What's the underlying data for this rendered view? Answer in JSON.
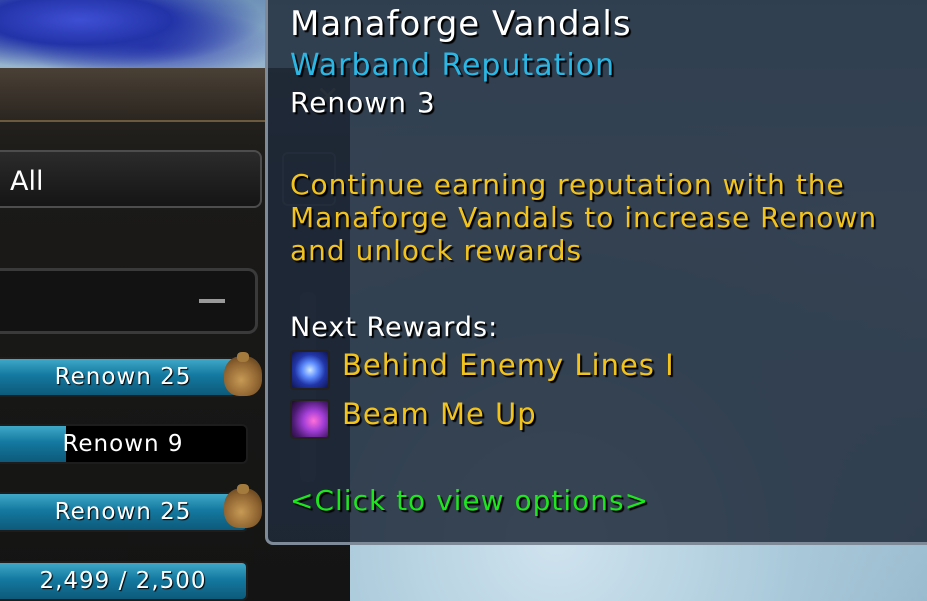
{
  "filter": {
    "label": "All"
  },
  "search": {
    "placeholder": ""
  },
  "bars": [
    {
      "label": "Renown 25",
      "fill": 1.0,
      "has_reward": true
    },
    {
      "label": "Renown 9",
      "fill": 0.27,
      "has_reward": false
    },
    {
      "label": "Renown 25",
      "fill": 1.0,
      "has_reward": true
    },
    {
      "label": "2,499 / 2,500",
      "fill": 0.9996,
      "has_reward": false
    }
  ],
  "tooltip": {
    "title": "Manaforge Vandals",
    "subtitle": "Warband Reputation",
    "renown": "Renown 3",
    "description": "Continue earning reputation with the Manaforge Vandals to increase Renown and unlock rewards",
    "next_rewards_label": "Next Rewards:",
    "rewards": [
      {
        "name": "Behind Enemy Lines I",
        "icon": "behind-enemy-lines-icon"
      },
      {
        "name": "Beam Me Up",
        "icon": "beam-me-up-icon"
      }
    ],
    "action_hint": "<Click to view options>"
  },
  "colors": {
    "title": "#ffffff",
    "subtitle": "#2bb6e4",
    "description": "#f2c21d",
    "action_hint": "#1ee51e",
    "bar_fill": "#1479a0"
  }
}
